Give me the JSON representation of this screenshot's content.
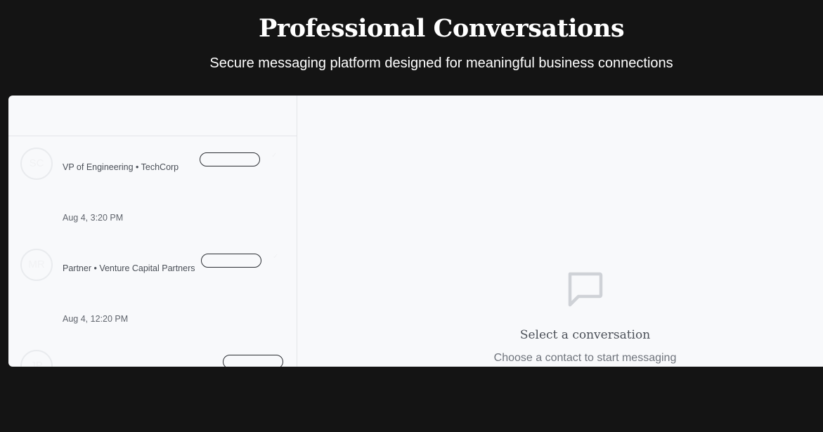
{
  "hero": {
    "title": "Professional Conversations",
    "subtitle": "Secure messaging platform designed for meaningful business connections"
  },
  "sidebar": {
    "header": "",
    "contacts": [
      {
        "initials": "SC",
        "name": "",
        "role": "VP of Engineering • TechCorp",
        "time": "Aug 4, 3:20 PM"
      },
      {
        "initials": "MR",
        "name": "",
        "role": "Partner • Venture Capital Partners",
        "time": "Aug 4, 12:20 PM"
      },
      {
        "initials": "JP",
        "name": "",
        "role": "",
        "time": ""
      }
    ]
  },
  "chat": {
    "icon": "message-square-icon",
    "empty_title": "Select a conversation",
    "empty_subtitle": "Choose a contact to start messaging"
  },
  "colors": {
    "page_background": "#141414",
    "panel_background": "#f8f9fb",
    "icon_color": "#cfd2d7"
  }
}
